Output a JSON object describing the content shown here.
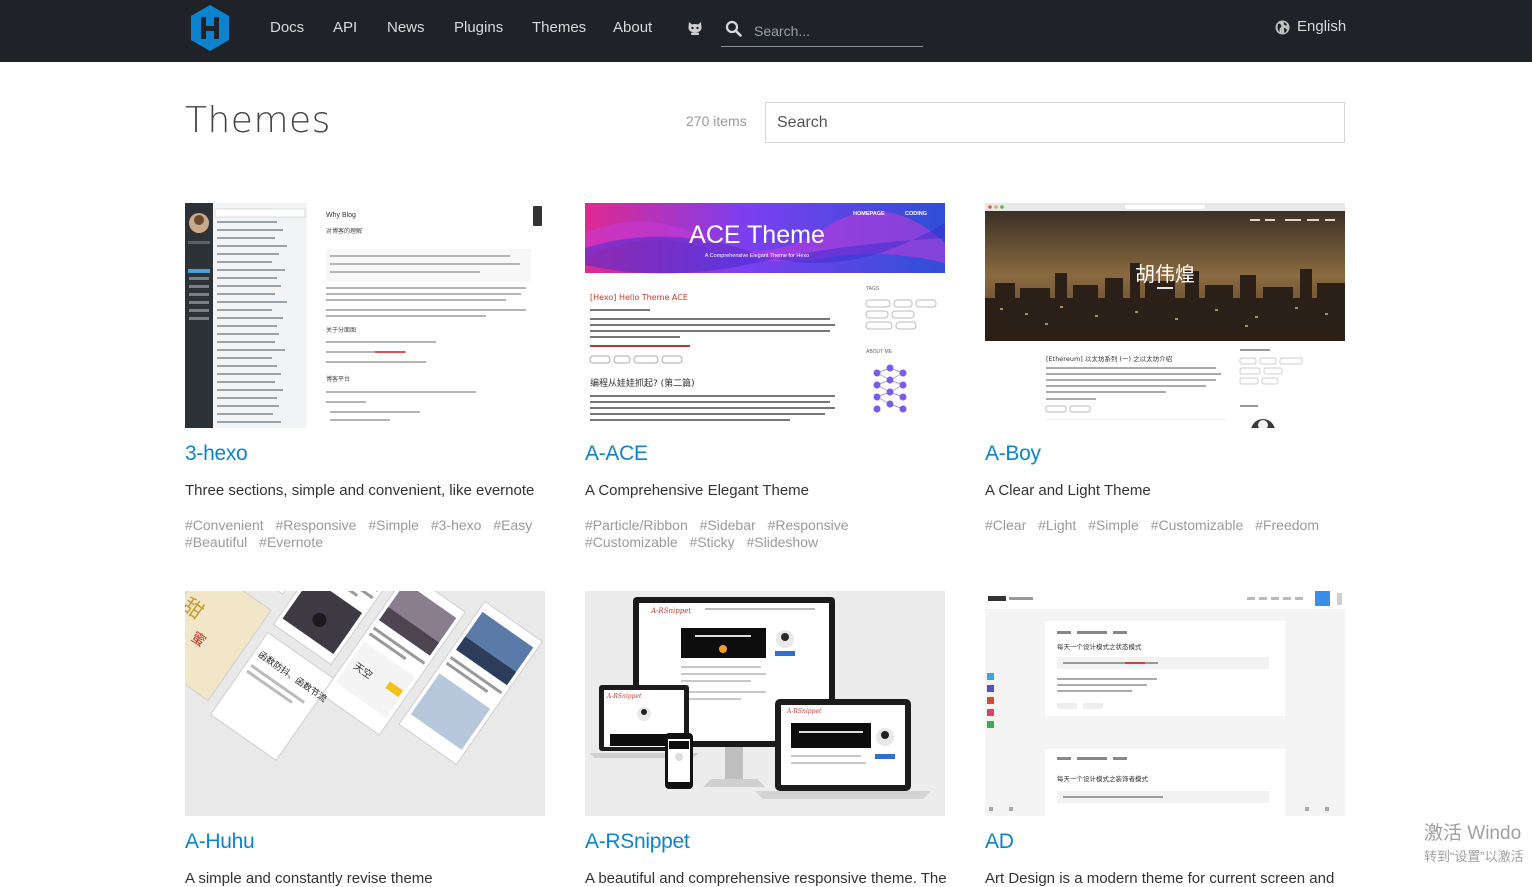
{
  "header": {
    "nav": [
      {
        "label": "Docs"
      },
      {
        "label": "API"
      },
      {
        "label": "News"
      },
      {
        "label": "Plugins"
      },
      {
        "label": "Themes"
      },
      {
        "label": "About"
      }
    ],
    "search_placeholder": "Search...",
    "language": "English",
    "colors": {
      "bar": "#1f2327",
      "logo": "#0e83cd"
    }
  },
  "page": {
    "title": "Themes",
    "count": "270 items",
    "filter_placeholder": "Search"
  },
  "themes": [
    {
      "name": "3-hexo",
      "description": "Three sections, simple and convenient, like evernote",
      "tags": [
        "#Convenient",
        "#Responsive",
        "#Simple",
        "#3-hexo",
        "#Easy",
        "#Beautiful",
        "#Evernote"
      ],
      "preview_text": [
        "Why Blog",
        "对博客的理解",
        "关于分面图",
        "博客平台"
      ]
    },
    {
      "name": "A-ACE",
      "description": "A Comprehensive Elegant Theme",
      "tags": [
        "#Particle/Ribbon",
        "#Sidebar",
        "#Responsive",
        "#Customizable",
        "#Sticky",
        "#Slideshow"
      ],
      "preview_text": [
        "ACE Theme",
        "A Comprehensive Elegant Theme for Hexo",
        "HOMEPAGE",
        "CODING",
        "[Hexo] Hello Theme ACE",
        "编程从娃娃抓起? (第二篇)",
        "TAGS",
        "ABOUT ME"
      ]
    },
    {
      "name": "A-Boy",
      "description": "A Clear and Light Theme",
      "tags": [
        "#Clear",
        "#Light",
        "#Simple",
        "#Customizable",
        "#Freedom"
      ],
      "preview_text": [
        "胡伟煌",
        "[Ethereum] 以太坊系列 (一) 之以太坊介绍"
      ]
    },
    {
      "name": "A-Huhu",
      "description": "A simple and constantly revise theme",
      "tags": [],
      "preview_text": [
        "天空",
        "函数防抖、函数节流"
      ]
    },
    {
      "name": "A-RSnippet",
      "description": "A beautiful and comprehensive responsive theme. The",
      "tags": [],
      "preview_text": [
        "A-RSnippet"
      ]
    },
    {
      "name": "AD",
      "description": "Art Design is a modern theme for current screen and",
      "tags": [],
      "preview_text": [
        "每天一个设计模式之状态模式",
        "每天一个设计模式之装饰者模式"
      ]
    }
  ],
  "watermark": {
    "line1": "激活 Windo",
    "line2": "转到“设置”以激活"
  }
}
